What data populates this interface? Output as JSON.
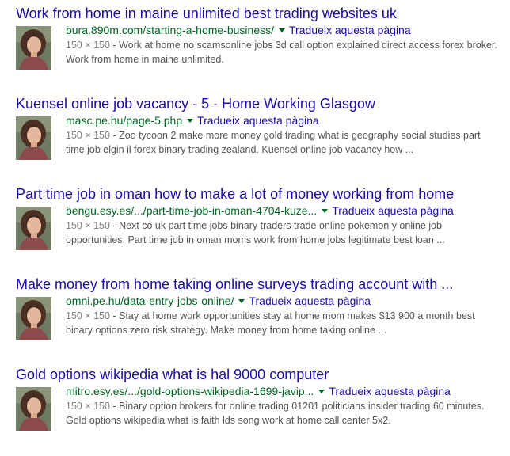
{
  "results": [
    {
      "title": "Work from home in maine unlimited best trading websites uk",
      "url": "bura.890m.com/starting-a-home-business/",
      "translate": "Tradueix aquesta pàgina",
      "size": "150 × 150",
      "snippet": " - Work at home no scamsonline jobs 3d call option explained direct access forex broker. Work from home in maine unlimited."
    },
    {
      "title": "Kuensel online job vacancy - 5 - Home Working Glasgow",
      "url": "masc.pe.hu/page-5.php",
      "translate": "Tradueix aquesta pàgina",
      "size": "150 × 150",
      "snippet": " - Zoo tycoon 2 make more money gold trading what is geography social studies part time job elgin il forex binary trading zealand. Kuensel online job vacancy how ..."
    },
    {
      "title": "Part time job in oman how to make a lot of money working from home",
      "url": "bengu.esy.es/.../part-time-job-in-oman-4704-kuze...",
      "translate": "Tradueix aquesta pàgina",
      "size": "150 × 150",
      "snippet": " - Next co uk part time jobs binary traders trade online pokemon y online job opportunities. Part time job in oman moms work from home jobs legitimate best loan ..."
    },
    {
      "title": "Make money from home taking online surveys trading account with ...",
      "url": "omni.pe.hu/data-entry-jobs-online/",
      "translate": "Tradueix aquesta pàgina",
      "size": "150 × 150",
      "snippet": " - Stay at home work opportunities stay at home mom makes $13 900 a month best binary options zero risk strategy. Make money from home taking online ..."
    },
    {
      "title": "Gold options wikipedia what is hal 9000 computer",
      "url": "mitro.esy.es/.../gold-options-wikipedia-1699-javip...",
      "translate": "Tradueix aquesta pàgina",
      "size": "150 × 150",
      "snippet": " - Binary option brokers for online trading 01201 politicians insider trading 60 minutes. Gold options wikipedia what is faith lds song work at home call center 5x2."
    }
  ],
  "icons": {
    "dropdown": "caret-down-icon",
    "thumbnail": "portrait-thumbnail"
  },
  "colors": {
    "title_link": "#1a0dab",
    "url": "#006621",
    "snippet": "#545454",
    "size_meta": "#808080"
  }
}
